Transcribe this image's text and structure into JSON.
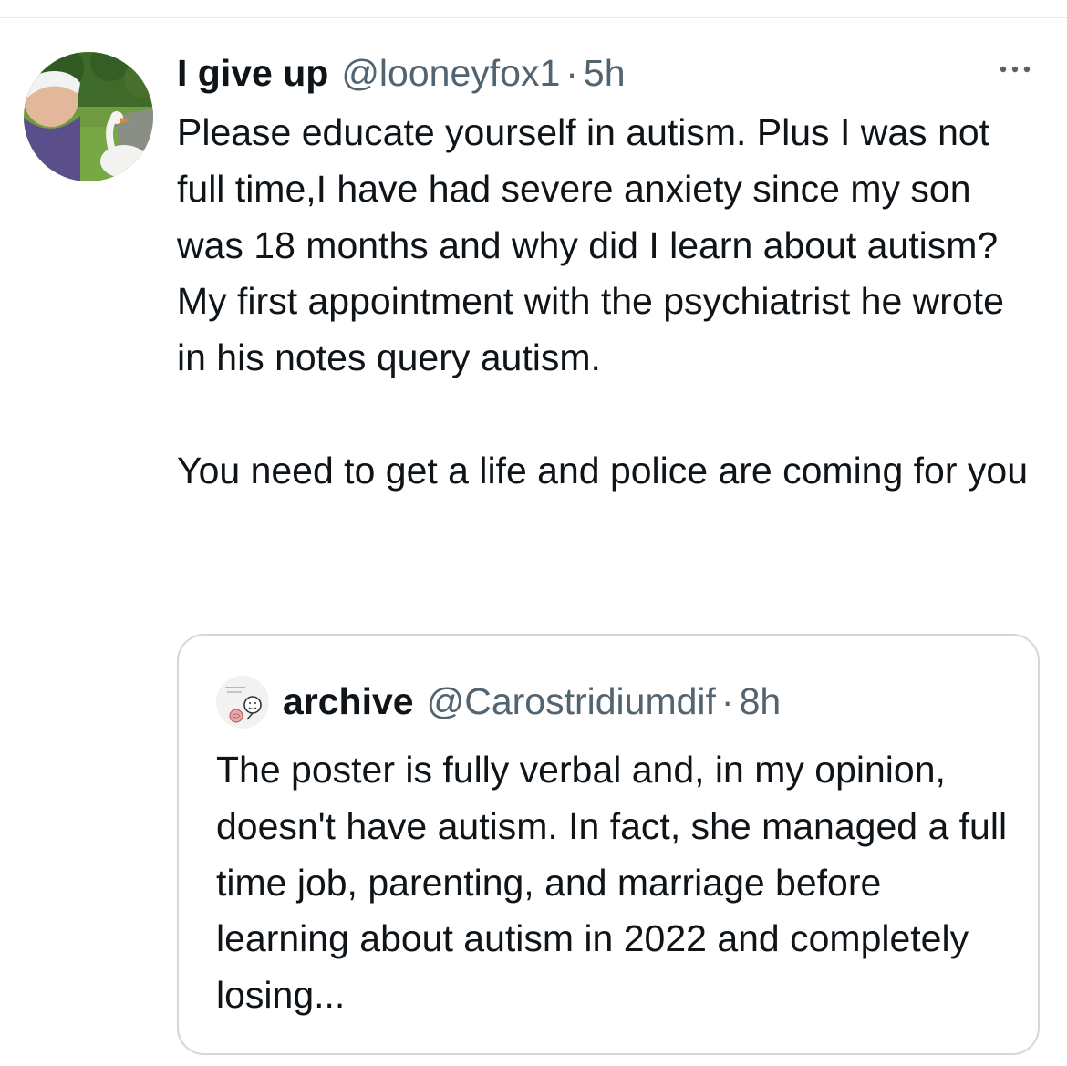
{
  "colors": {
    "primary_text": "#0f1419",
    "secondary_text": "#536471",
    "border": "#cfd9de"
  },
  "tweet": {
    "author": {
      "display_name": "I give up",
      "handle": "@looneyfox1",
      "separator": "·",
      "time": "5h",
      "avatar_icon": "user-avatar-photo"
    },
    "more_icon": "more-horizontal-icon",
    "paragraphs": [
      "Please educate yourself in autism.  Plus I was not full time,I have had severe anxiety since my son was 18 months and why did I learn about autism? My first appointment with the psychiatrist he wrote in his notes query autism.",
      "You need to get a life and police are coming for you"
    ],
    "quoted_tweet": {
      "display_name": "archive",
      "handle": "@Carostridiumdif",
      "separator": "·",
      "time": "8h",
      "avatar_icon": "quoted-user-avatar",
      "text": "The poster is fully verbal and, in my opinion, doesn't have autism. In fact, she managed a full time job, parenting, and marriage before learning about autism in 2022 and completely losing..."
    }
  }
}
